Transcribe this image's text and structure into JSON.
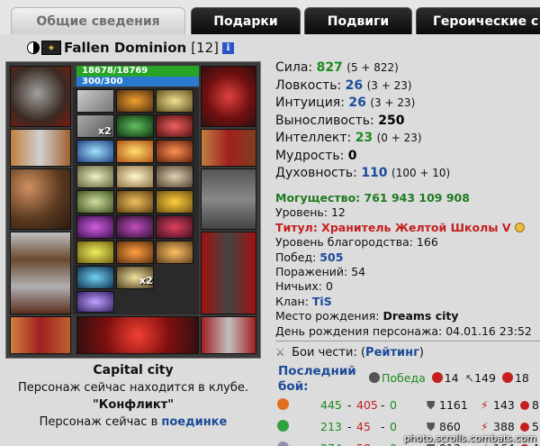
{
  "tabs": [
    {
      "label": "Общие сведения",
      "active": true
    },
    {
      "label": "Подарки"
    },
    {
      "label": "Подвиги"
    },
    {
      "label": "Героические с"
    }
  ],
  "character": {
    "name": "Fallen Dominion",
    "level": "[12]",
    "clan_icon": "clan-emblem-icon",
    "info_icon": "i"
  },
  "bars": {
    "hp": "18678/18769",
    "hp_fill": 0.995,
    "mp": "300/300",
    "mp_fill": 1.0
  },
  "doll_labels": {
    "x2_a": "x2",
    "x2_b": "x2"
  },
  "location": {
    "city": "Capital city",
    "line1": "Персонаж сейчас находится в клубе.",
    "club": "\"Конфликт\"",
    "line3_prefix": "Персонаж сейчас в",
    "line3_link": "поединке"
  },
  "stats": [
    {
      "label": "Сила:",
      "value": "827",
      "color": "#1e8a1e",
      "extra": "(5 + 822)"
    },
    {
      "label": "Ловкость:",
      "value": "26",
      "color": "#1c4b9a",
      "extra": "(3 + 23)"
    },
    {
      "label": "Интуиция:",
      "value": "26",
      "color": "#1c4b9a",
      "extra": "(3 + 23)"
    },
    {
      "label": "Выносливость:",
      "value": "250",
      "color": "#000000",
      "extra": ""
    },
    {
      "label": "Интеллект:",
      "value": "23",
      "color": "#1e8a1e",
      "extra": "(0 + 23)"
    },
    {
      "label": "Мудрость:",
      "value": "0",
      "color": "#000000",
      "extra": ""
    },
    {
      "label": "Духовность:",
      "value": "110",
      "color": "#1c4b9a",
      "extra": "(100 + 10)"
    }
  ],
  "info": {
    "power": "Могущество: 761 943 109 908",
    "level": "Уровень: 12",
    "title": "Титул: Хранитель Желтой Школы V",
    "nobility": "Уровень благородства: 166",
    "wins_label": "Побед:",
    "wins": "505",
    "losses": "Поражений: 54",
    "draws": "Ничьих: 0",
    "clan_label": "Клан:",
    "clan": "TiS",
    "birthplace_label": "Место рождения:",
    "birthplace": "Dreams city",
    "birthday": "День рождения персонажа: 04.01.16 23:52"
  },
  "honor": {
    "label": "Бои чести:",
    "open": "(",
    "link": "Рейтинг",
    "close": ")"
  },
  "last_fight": {
    "l1": "Последний",
    "l2": "бой:"
  },
  "summary": {
    "win_label": "Победа",
    "v1": "14",
    "v2": "149",
    "v3": "18"
  },
  "fight_rows": [
    {
      "a": "445",
      "b": "405",
      "c": "0",
      "d": "1161",
      "e": "143",
      "f": "8"
    },
    {
      "a": "213",
      "b": "45",
      "c": "0",
      "d": "860",
      "e": "388",
      "f": "5"
    },
    {
      "a": "274",
      "b": "58",
      "c": "0",
      "d": "913",
      "e": "164",
      "f": "4"
    }
  ],
  "separator": "-",
  "watermark": "photo.scrolls.combats.com"
}
